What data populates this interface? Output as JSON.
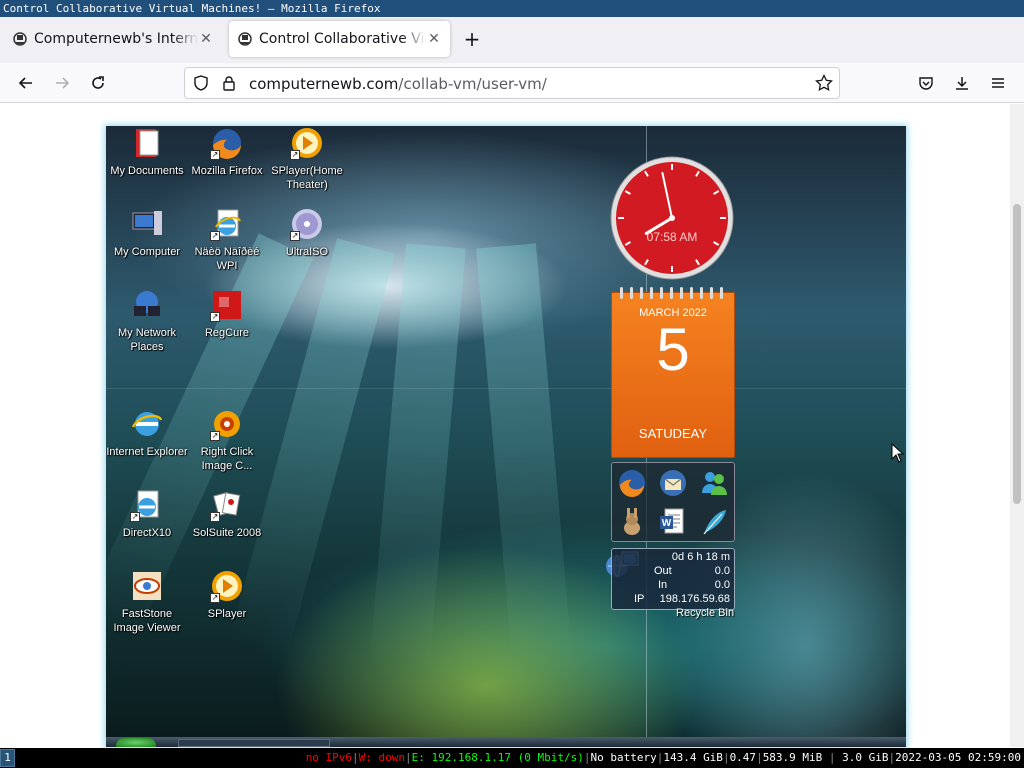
{
  "window": {
    "title": "Control Collaborative Virtual Machines! — Mozilla Firefox"
  },
  "tabs": [
    {
      "label": "Computernewb's Internet",
      "active": false
    },
    {
      "label": "Control Collaborative Virtual Machines!",
      "active": true
    }
  ],
  "navbar": {
    "url_host": "computernewb.com",
    "url_path": "/collab-vm/user-vm/"
  },
  "vm": {
    "desktop_icons": [
      {
        "label": "My Documents",
        "icon": "my-documents-icon"
      },
      {
        "label": "Mozilla Firefox",
        "icon": "firefox-icon"
      },
      {
        "label": "SPlayer(Home Theater)",
        "icon": "splayer-icon"
      },
      {
        "label": "My Computer",
        "icon": "my-computer-icon"
      },
      {
        "label": "Näèö Näîðèé WPI",
        "icon": "ie-installer-icon"
      },
      {
        "label": "UltraISO",
        "icon": "ultraiso-icon"
      },
      {
        "label": "My Network Places",
        "icon": "network-places-icon"
      },
      {
        "label": "RegCure",
        "icon": "regcure-icon"
      },
      {
        "label": "Internet Explorer",
        "icon": "internet-explorer-icon"
      },
      {
        "label": "Right Click Image C...",
        "icon": "right-click-image-icon"
      },
      {
        "label": "DirectX10",
        "icon": "directx-icon"
      },
      {
        "label": "SolSuite 2008",
        "icon": "solsuite-icon"
      },
      {
        "label": "FastStone Image Viewer",
        "icon": "faststone-icon"
      },
      {
        "label": "SPlayer",
        "icon": "splayer-icon"
      }
    ],
    "clock": {
      "time": "07:58 AM",
      "hour": 7,
      "minute": 58
    },
    "calendar": {
      "month": "MARCH 2022",
      "day": "5",
      "weekday": "SATUDEAY"
    },
    "launcher": [
      "firefox-icon",
      "thunderbird-icon",
      "messenger-icon",
      "winamp-icon",
      "word-icon",
      "feather-icon"
    ],
    "netmon": {
      "uptime": "0d 6 h 18 m",
      "out_label": "Out",
      "out_value": "0.0",
      "in_label": "In",
      "in_value": "0.0",
      "ip_label": "IP",
      "ip_value": "198.176.59.68"
    },
    "recycle_bin": "Recycle Bin"
  },
  "statusbar": {
    "workspace": "1",
    "ipv6": "no IPv6",
    "wifi": "W: down",
    "ethernet": "E: 192.168.1.17 (0 Mbit/s)",
    "battery": "No battery",
    "disk": "143.4 GiB",
    "load": "0.47",
    "memory": "583.9 MiB",
    "swap": "3.0 GiB",
    "datetime": "2022-03-05 02:59:00"
  }
}
